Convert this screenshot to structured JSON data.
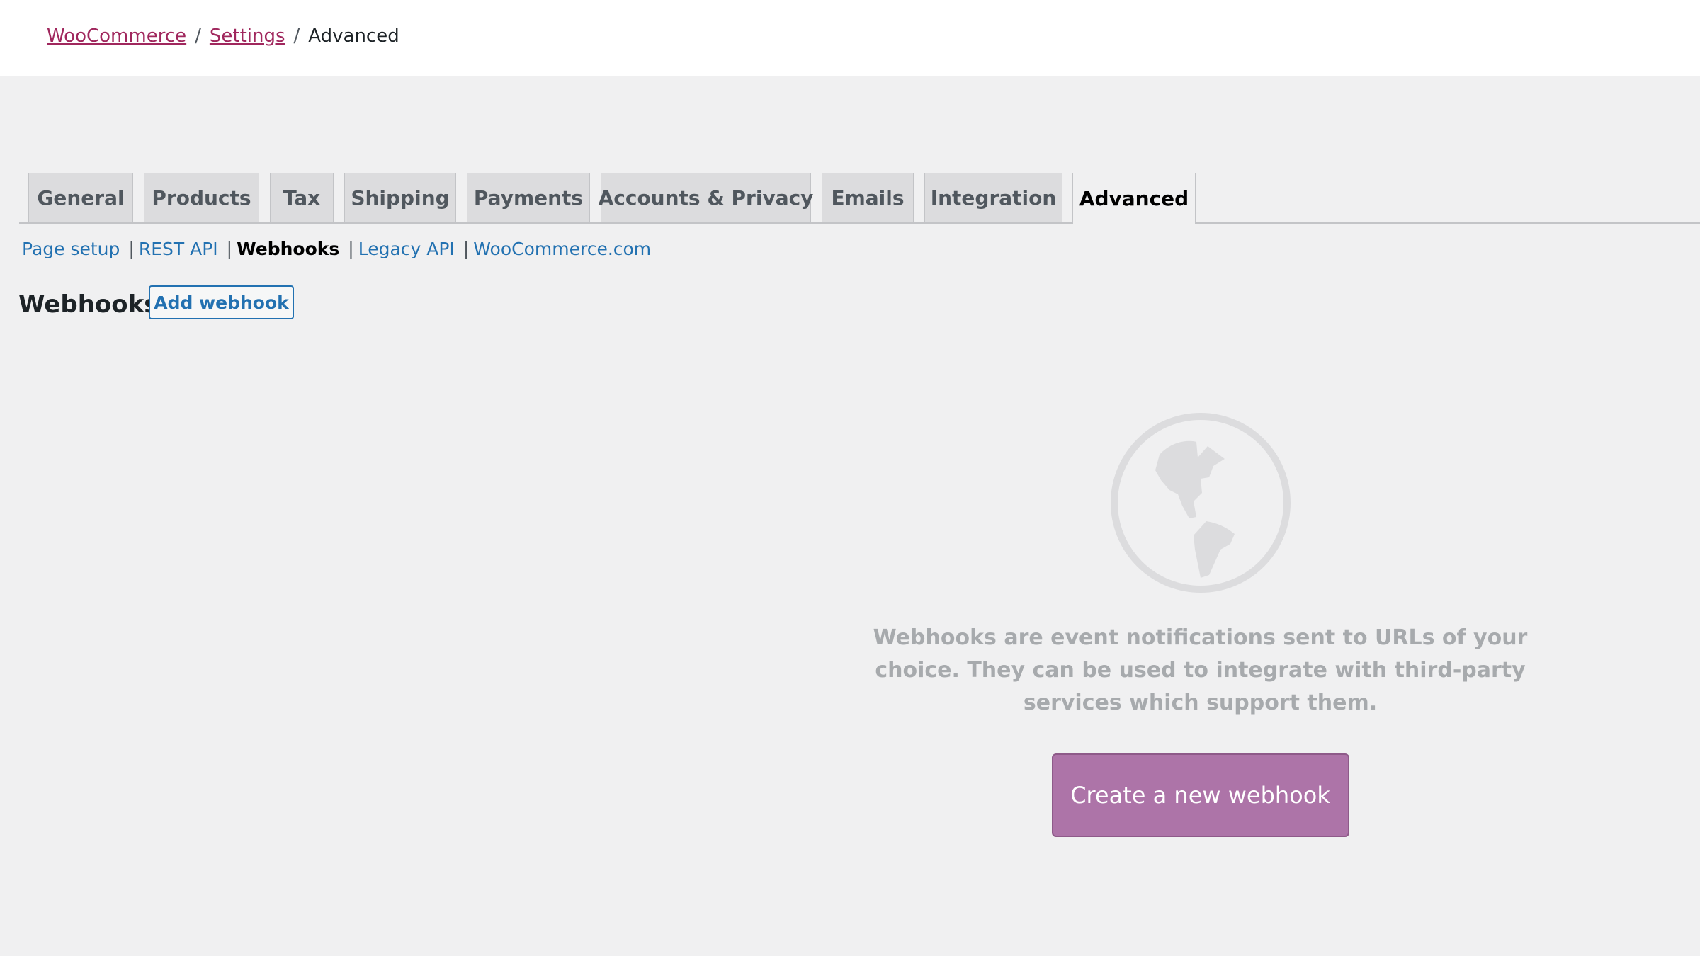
{
  "breadcrumb": {
    "items": [
      "WooCommerce",
      "Settings"
    ],
    "separator": "/",
    "current": "Advanced"
  },
  "tabs": [
    {
      "label": "General",
      "active": false
    },
    {
      "label": "Products",
      "active": false
    },
    {
      "label": "Tax",
      "active": false
    },
    {
      "label": "Shipping",
      "active": false
    },
    {
      "label": "Payments",
      "active": false
    },
    {
      "label": "Accounts & Privacy",
      "active": false
    },
    {
      "label": "Emails",
      "active": false
    },
    {
      "label": "Integration",
      "active": false
    },
    {
      "label": "Advanced",
      "active": true
    }
  ],
  "subnav": {
    "items": [
      "Page setup",
      "REST API",
      "Webhooks",
      "Legacy API",
      "WooCommerce.com"
    ],
    "current": "Webhooks",
    "separator": "|"
  },
  "page": {
    "title": "Webhooks",
    "add_label": "Add webhook"
  },
  "empty_state": {
    "icon": "globe-icon",
    "message": "Webhooks are event notifications sent to URLs of your choice. They can be used to integrate with third-party services which support them.",
    "cta_label": "Create a new webhook"
  },
  "colors": {
    "link": "#2271b1",
    "breadcrumb_link": "#a0275d",
    "cta": "#ad74a8",
    "icon": "#dcdcde"
  }
}
